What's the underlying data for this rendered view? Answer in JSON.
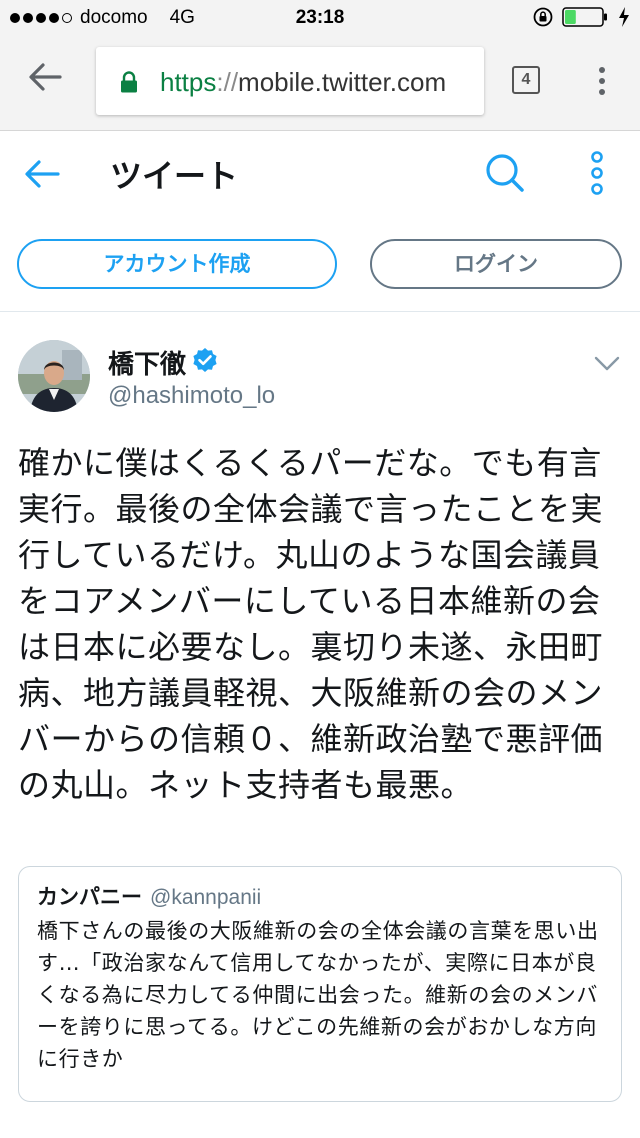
{
  "status_bar": {
    "carrier": "docomo",
    "network": "4G",
    "time": "23:18",
    "signal_dots_filled": 4,
    "signal_dots_total": 5,
    "battery_level": 0.3,
    "battery_color": "#4cd964"
  },
  "browser": {
    "url_scheme": "https",
    "url_sep": "://",
    "url_host": "mobile.twitter.com",
    "tab_count": "4",
    "accent": "#0b8043"
  },
  "header": {
    "title": "ツイート",
    "icons": [
      "back-arrow-icon",
      "search-icon",
      "more-vertical-icon"
    ]
  },
  "auth": {
    "signup_label": "アカウント作成",
    "login_label": "ログイン"
  },
  "tweet": {
    "author_name": "橋下徹",
    "author_handle": "@hashimoto_lo",
    "verified": true,
    "text": "確かに僕はくるくるパーだな。でも有言実行。最後の全体会議で言ったことを実行しているだけ。丸山のような国会議員をコアメンバーにしている日本維新の会は日本に必要なし。裏切り未遂、永田町病、地方議員軽視、大阪維新の会のメンバーからの信頼０、維新政治塾で悪評価の丸山。ネット支持者も最悪。",
    "quoted": {
      "name": "カンパニー",
      "handle": "@kannpanii",
      "text": "橋下さんの最後の大阪維新の会の全体会議の言葉を思い出す…「政治家なんて信用してなかったが、実際に日本が良くなる為に尽力してる仲間に出会った。維新の会のメンバーを誇りに思ってる。けどこの先維新の会がおかしな方向に行きか"
    }
  },
  "colors": {
    "twitter_blue": "#1da1f2",
    "secondary_gray": "#657786"
  }
}
